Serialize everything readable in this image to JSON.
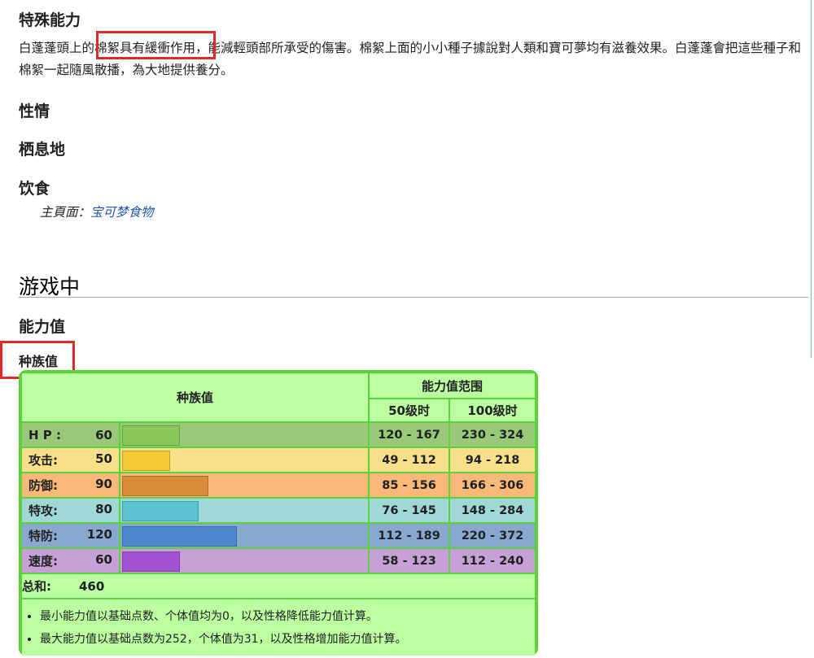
{
  "sections": {
    "special_ability": {
      "heading": "特殊能力",
      "text_before": "白蓬蓬頭上的",
      "text_highlight": "棉絮具有緩衝作用",
      "text_after": "，能減輕頭部所承受的傷害。棉絮上面的小小種子據說對人類和寶可夢均有滋養效果。白蓬蓬會把這些種子和棉絮一起隨風散播，為大地提供養分。"
    },
    "temperament": {
      "heading": "性情"
    },
    "habitat": {
      "heading": "栖息地"
    },
    "diet": {
      "heading": "饮食",
      "main_page_prefix": "主頁面：",
      "main_page_link": "宝可梦食物"
    }
  },
  "in_game": {
    "heading": "游戏中",
    "stats_heading": "能力值",
    "base_stats_heading": "种族值"
  },
  "stats_table": {
    "col_base": "种族值",
    "col_range": "能力值范围",
    "col_lv50": "50级时",
    "col_lv100": "100级时",
    "rows": [
      {
        "label": "H P :",
        "value": "60",
        "lv50": "120 - 167",
        "lv100": "230 - 324",
        "bg": "#98c878",
        "bar": "#89c75a",
        "fraction": 0.235
      },
      {
        "label": "攻击:",
        "value": "50",
        "lv50": "49 - 112",
        "lv100": "94 - 218",
        "bg": "#f8df8a",
        "bar": "#f1c837",
        "fraction": 0.196
      },
      {
        "label": "防御:",
        "value": "90",
        "lv50": "85 - 156",
        "lv100": "166 - 306",
        "bg": "#f8b878",
        "bar": "#d98c38",
        "fraction": 0.353
      },
      {
        "label": "特攻:",
        "value": "80",
        "lv50": "76 - 145",
        "lv100": "148 - 284",
        "bg": "#a0d8d8",
        "bar": "#5ac3cf",
        "fraction": 0.314
      },
      {
        "label": "特防:",
        "value": "120",
        "lv50": "112 - 189",
        "lv100": "220 - 372",
        "bg": "#88a8d0",
        "bar": "#4e88cc",
        "fraction": 0.471
      },
      {
        "label": "速度:",
        "value": "60",
        "lv50": "58 - 123",
        "lv100": "112 - 240",
        "bg": "#c8a0d8",
        "bar": "#a452d4",
        "fraction": 0.235
      }
    ],
    "total_label": "总和:",
    "total_value": "460",
    "notes": [
      "最小能力值以基础点数、个体值均为0，以及性格降低能力值计算。",
      "最大能力值以基础点数为252，个体值为31，以及性格增加能力值计算。"
    ]
  },
  "colors": {
    "highlight_border": "#e02a2a",
    "table_border": "#5ad23a",
    "table_header_bg": "#bbffa0",
    "link": "#1f55a7"
  }
}
